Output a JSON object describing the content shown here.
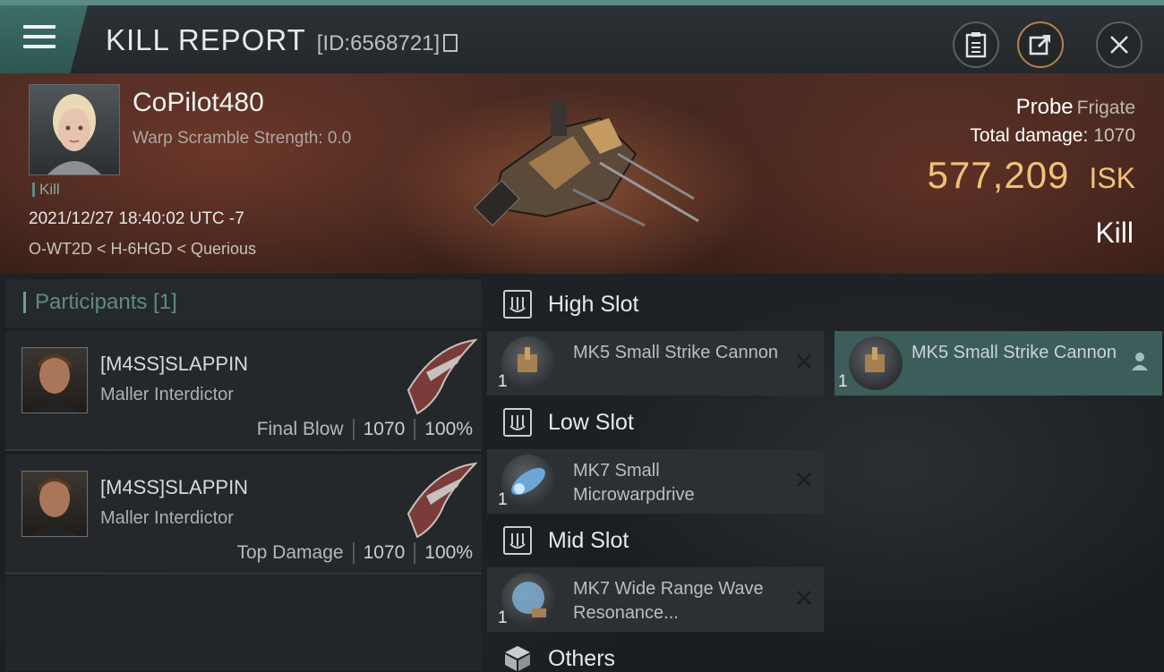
{
  "header": {
    "title": "KILL REPORT",
    "report_id": "[ID:6568721]"
  },
  "victim": {
    "name": "CoPilot480",
    "scramble_strength": "Warp Scramble Strength: 0.0",
    "kill_tag": "Kill",
    "timestamp": "2021/12/27 18:40:02 UTC -7",
    "location": "O-WT2D < H-6HGD < Querious",
    "ship_name": "Probe",
    "ship_class": "Frigate",
    "total_damage_label": "Total damage:",
    "total_damage": "1070",
    "isk_value": "577,209",
    "isk_unit": "ISK",
    "result": "Kill"
  },
  "participants": {
    "label": "Participants [1]",
    "items": [
      {
        "name": "[M4SS]SLAPPIN",
        "ship": "Maller Interdictor",
        "role": "Final Blow",
        "damage": "1070",
        "percent": "100%"
      },
      {
        "name": "[M4SS]SLAPPIN",
        "ship": "Maller Interdictor",
        "role": "Top Damage",
        "damage": "1070",
        "percent": "100%"
      }
    ]
  },
  "fitting": {
    "high_slot": {
      "label": "High Slot",
      "modules": [
        {
          "qty": "1",
          "name": "MK5 Small Strike Cannon"
        },
        {
          "qty": "1",
          "name": "MK5 Small Strike Cannon"
        }
      ]
    },
    "low_slot": {
      "label": "Low Slot",
      "modules": [
        {
          "qty": "1",
          "name": "MK7 Small Microwarpdrive"
        }
      ]
    },
    "mid_slot": {
      "label": "Mid Slot",
      "modules": [
        {
          "qty": "1",
          "name": "MK7 Wide Range Wave Resonance..."
        }
      ]
    },
    "others": {
      "label": "Others"
    }
  },
  "colors": {
    "accent": "#5c8c86",
    "isk": "#f0c27a",
    "highlight_module": "#3d5d5a"
  },
  "icons": [
    "menu-icon",
    "clipboard-icon",
    "share-icon",
    "close-icon",
    "copy-icon",
    "shield-slot-icon",
    "cube-icon",
    "remove-x-icon",
    "user-icon"
  ]
}
